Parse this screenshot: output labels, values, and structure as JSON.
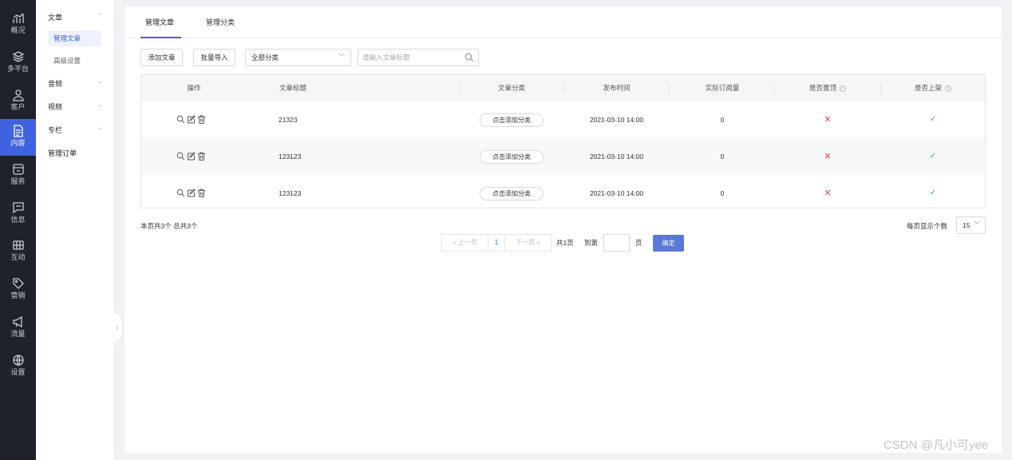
{
  "rail": {
    "items": [
      {
        "label": "概况",
        "icon": "chart-icon"
      },
      {
        "label": "多平台",
        "icon": "layers-icon"
      },
      {
        "label": "客户",
        "icon": "user-icon"
      },
      {
        "label": "内容",
        "icon": "document-icon",
        "active": true
      },
      {
        "label": "服务",
        "icon": "service-icon"
      },
      {
        "label": "信息",
        "icon": "message-icon"
      },
      {
        "label": "互动",
        "icon": "interaction-icon"
      },
      {
        "label": "营销",
        "icon": "tag-icon"
      },
      {
        "label": "流量",
        "icon": "megaphone-icon"
      },
      {
        "label": "设置",
        "icon": "globe-icon"
      }
    ]
  },
  "subnav": {
    "article_group": "文章",
    "article_items": [
      "管理文章",
      "高级设置"
    ],
    "audio_group": "音频",
    "video_group": "视频",
    "column_group": "专栏",
    "orders_item": "管理订单"
  },
  "tabs": [
    "管理文章",
    "管理分类"
  ],
  "toolbar": {
    "add_label": "添加文章",
    "import_label": "批量导入",
    "category_value": "全部分类",
    "search_placeholder": "请输入文章标题"
  },
  "table": {
    "headers": [
      "操作",
      "文章标题",
      "文章分类",
      "发布时间",
      "实际订阅量",
      "是否置顶",
      "是否上架"
    ],
    "rows": [
      {
        "title": "21323",
        "category": "点击添加分类",
        "date": "2021-03-10 14:00",
        "subs": "0",
        "pinned": "✕",
        "listed": "✓"
      },
      {
        "title": "123123",
        "category": "点击添加分类",
        "date": "2021-03-10 14:00",
        "subs": "0",
        "pinned": "✕",
        "listed": "✓"
      },
      {
        "title": "123123",
        "category": "点击添加分类",
        "date": "2021-03-10 14:00",
        "subs": "0",
        "pinned": "✕",
        "listed": "✓"
      }
    ]
  },
  "footer": {
    "summary": "本页共3个  总共3个",
    "prev": "上一页",
    "page": "1",
    "next": "下一页",
    "total_pages": "共1页",
    "goto_label": "到第",
    "page_unit": "页",
    "confirm": "确定",
    "per_page_label": "每页显示个数",
    "per_page_value": "15"
  },
  "colors": {
    "accent": "#3f63e0",
    "rail_bg": "#1f2329",
    "cross": "#e5484d",
    "check": "#2fb65b"
  },
  "watermark": "CSDN @凡小可yee"
}
